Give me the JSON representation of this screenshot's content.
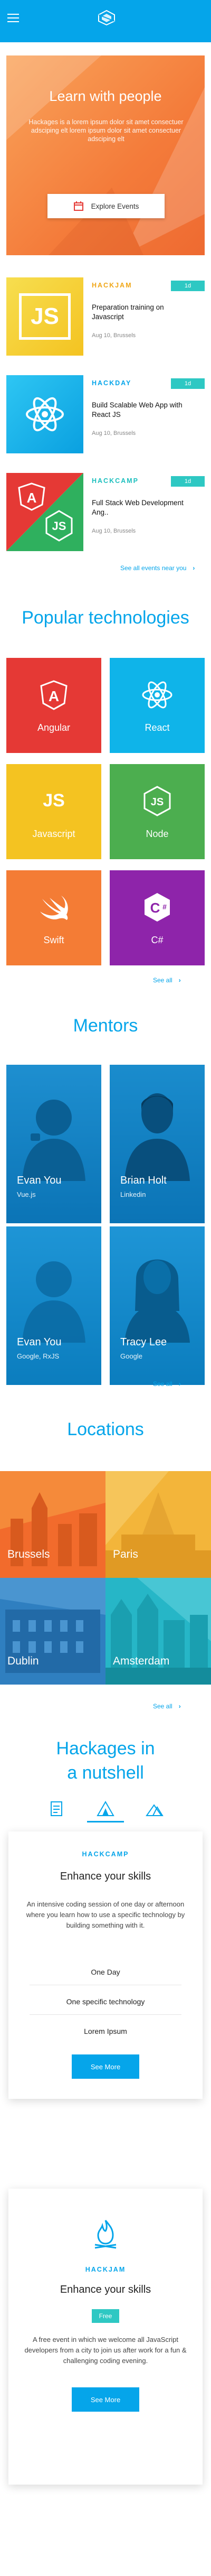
{
  "header": {
    "menu_icon": "hamburger-icon",
    "logo_icon": "hackages-logo-icon",
    "brand_color": "#05a5ea"
  },
  "hero": {
    "title": "Learn with people",
    "description": "Hackages is a lorem ipsum dolor sit amet consectuer adsciping elt lorem ipsum dolor sit amet consectuer adsciping elt",
    "button_label": "Explore Events",
    "button_icon": "calendar-icon",
    "color": "#f58c3a"
  },
  "events": [
    {
      "category": "HACKJAM",
      "category_color": "#f0a616",
      "badge": "1d",
      "title": "Preparation training on Javascript",
      "meta": "Aug 10, Brussels",
      "thumb_color": "#f6d63a"
    },
    {
      "category": "HACKDAY",
      "category_color": "#05a5ea",
      "badge": "1d",
      "title": "Build Scalable Web App with React JS",
      "meta": "Aug 10, Brussels",
      "thumb_color": "#10b4ea"
    },
    {
      "category": "HACKCAMP",
      "category_color": "#1cbfbe",
      "badge": "1d",
      "title": "Full Stack Web Development Ang..",
      "meta": "Aug 10, Brussels",
      "thumb_color": "#e53935"
    }
  ],
  "events_see_all": "See all events near you",
  "technologies": {
    "title": "Popular technologies",
    "items": [
      {
        "label": "Angular",
        "color": "#e53935",
        "icon": "angular-icon"
      },
      {
        "label": "React",
        "color": "#0fb4e9",
        "icon": "react-icon"
      },
      {
        "label": "Javascript",
        "color": "#f4c321",
        "icon": "javascript-icon"
      },
      {
        "label": "Node",
        "color": "#4cae4f",
        "icon": "node-icon"
      },
      {
        "label": "Swift",
        "color": "#f47c35",
        "icon": "swift-icon"
      },
      {
        "label": "C#",
        "color": "#8e24aa",
        "icon": "csharp-icon"
      }
    ],
    "see_all": "See all"
  },
  "mentors": {
    "title": "Mentors",
    "items": [
      {
        "name": "Evan You",
        "sub": "Vue.js"
      },
      {
        "name": "Brian Holt",
        "sub": "Linkedin"
      },
      {
        "name": "Evan You",
        "sub": "Google, RxJS"
      },
      {
        "name": "Tracy Lee",
        "sub": "Google"
      }
    ],
    "see_all": "See all"
  },
  "locations": {
    "title": "Locations",
    "items": [
      {
        "name": "Brussels",
        "color": "#f26b2c"
      },
      {
        "name": "Paris",
        "color": "#f3b53a"
      },
      {
        "name": "Dublin",
        "color": "#2f7fc0"
      },
      {
        "name": "Amsterdam",
        "color": "#26b6c7"
      }
    ],
    "see_all": "See all"
  },
  "nutshell": {
    "title_line1": "Hackages in",
    "title_line2": "a nutshell",
    "tabs": [
      {
        "icon": "document-icon"
      },
      {
        "icon": "tent-icon"
      },
      {
        "icon": "mountain-icon"
      }
    ],
    "cards": [
      {
        "category": "HACKCAMP",
        "heading": "Enhance your skills",
        "description": "An intensive coding session of one day or afternoon where you learn how to use a specific technology by building something with it.",
        "items": [
          "One Day",
          "One specific technology",
          "Lorem Ipsum"
        ],
        "button": "See More"
      },
      {
        "icon": "campfire-icon",
        "category": "HACKJAM",
        "heading": "Enhance your skills",
        "badge": "Free",
        "description": "A free event in which we welcome all JavaScript developers from a city to join us after work for a fun & challenging coding evening.",
        "button": "See More"
      }
    ]
  }
}
